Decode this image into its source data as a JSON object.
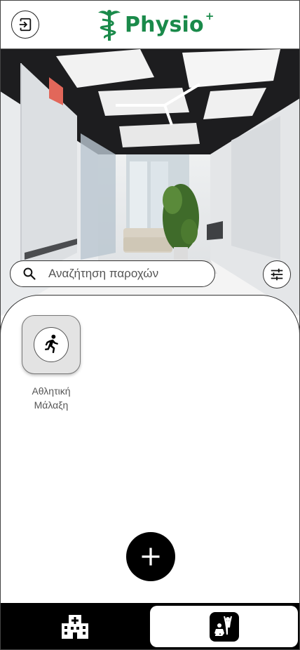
{
  "header": {
    "brand_name": "Physio",
    "brand_sup": "+",
    "logout_icon": "logout-icon",
    "logo_icon": "caduceus-icon",
    "brand_color": "#1a8a4a"
  },
  "search": {
    "placeholder": "Αναζήτηση παροχών",
    "value": ""
  },
  "services": [
    {
      "label_line1": "Αθλητική",
      "label_line2": "Μάλαξη",
      "icon": "running-person-icon"
    }
  ],
  "actions": {
    "add_icon": "plus-icon",
    "filter_icon": "sliders-icon"
  },
  "bottom_nav": {
    "items": [
      {
        "icon": "hospital-icon",
        "active": false
      },
      {
        "icon": "physio-exercise-icon",
        "active": true
      }
    ]
  }
}
